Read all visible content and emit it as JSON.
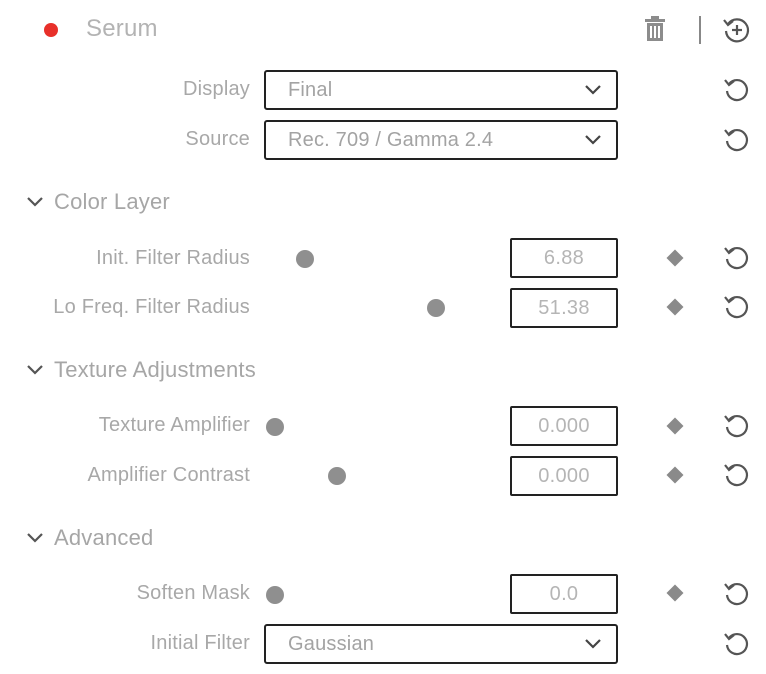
{
  "header": {
    "effect_name": "Serum",
    "enable_dot_color": "#e8302a",
    "icons": [
      "trash-icon",
      "reset-all-icon"
    ]
  },
  "display": {
    "label": "Display",
    "value": "Final"
  },
  "source": {
    "label": "Source",
    "value": "Rec. 709 / Gamma 2.4"
  },
  "sections": {
    "color_layer": "Color Layer",
    "texture_adjustments": "Texture Adjustments",
    "advanced": "Advanced"
  },
  "params": {
    "init_filter_radius": {
      "label": "Init. Filter Radius",
      "value": "6.88"
    },
    "lo_freq_filter_radius": {
      "label": "Lo Freq. Filter Radius",
      "value": "51.38"
    },
    "texture_amplifier": {
      "label": "Texture Amplifier",
      "value": "0.000"
    },
    "amplifier_contrast": {
      "label": "Amplifier Contrast",
      "value": "0.000"
    },
    "soften_mask": {
      "label": "Soften Mask",
      "value": "0.0"
    }
  },
  "initial_filter": {
    "label": "Initial Filter",
    "value": "Gaussian"
  }
}
